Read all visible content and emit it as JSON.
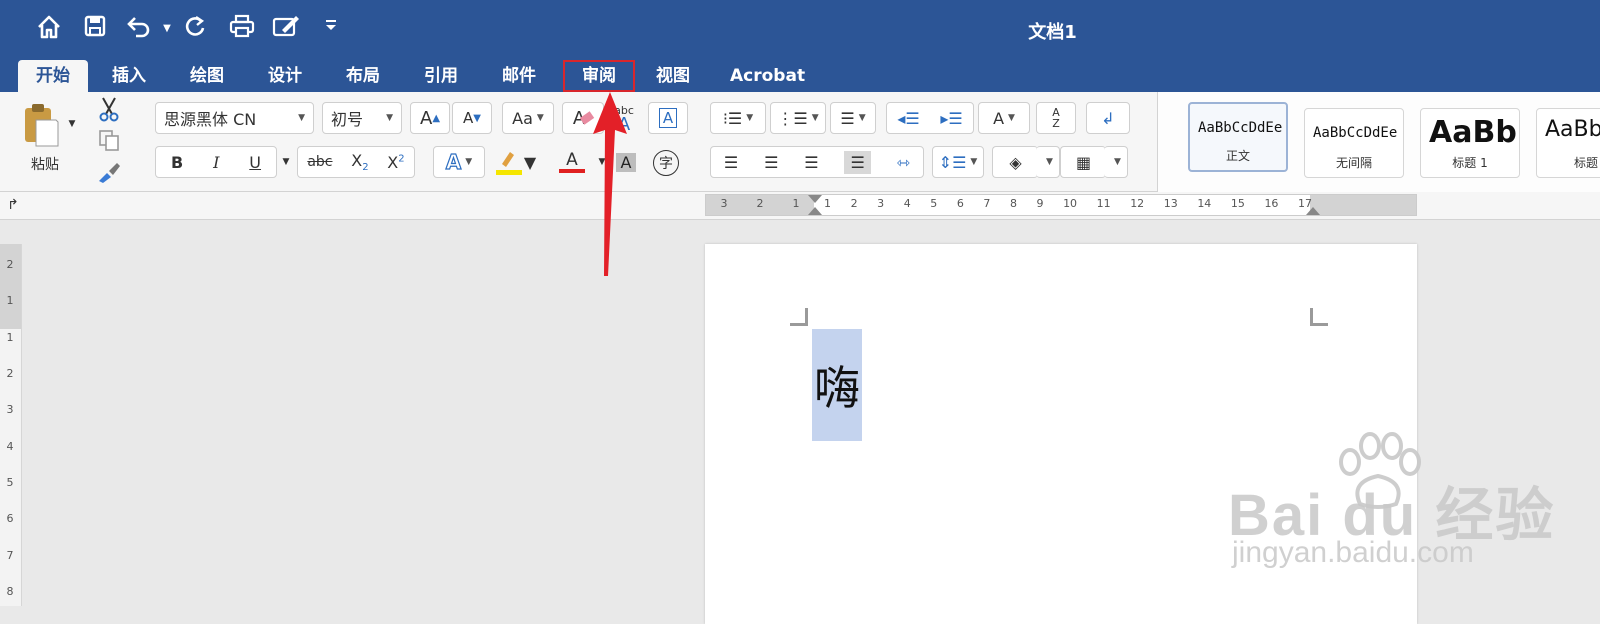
{
  "window": {
    "title": "文档1"
  },
  "quick_access": {
    "icons": [
      "home-icon",
      "save-icon",
      "undo-icon",
      "redo-icon",
      "print-icon",
      "edit-icon",
      "customize-icon"
    ]
  },
  "tabs": [
    {
      "label": "开始",
      "active": true
    },
    {
      "label": "插入"
    },
    {
      "label": "绘图"
    },
    {
      "label": "设计"
    },
    {
      "label": "布局"
    },
    {
      "label": "引用"
    },
    {
      "label": "邮件"
    },
    {
      "label": "审阅",
      "highlighted": true
    },
    {
      "label": "视图"
    },
    {
      "label": "Acrobat"
    }
  ],
  "ribbon": {
    "paste_label": "粘贴",
    "font_name": "思源黑体 CN",
    "font_size": "初号",
    "grow_font": "A",
    "shrink_font": "A",
    "change_case": "Aa",
    "clear_format": "A",
    "phonetic_top": "abc",
    "phonetic_bottom": "A",
    "char_border": "A",
    "bold": "B",
    "italic": "I",
    "underline": "U",
    "strike": "abc",
    "subscript": "X",
    "subscript_sub": "2",
    "superscript": "X",
    "superscript_sup": "2",
    "text_effect": "A",
    "font_color": "A",
    "char_shading": "A",
    "enclose": "字",
    "sort": "A",
    "sort_sub": "Z",
    "text_direction": "A",
    "styles": [
      {
        "sample": "AaBbCcDdEe",
        "name": "正文",
        "active": true
      },
      {
        "sample": "AaBbCcDdEe",
        "name": "无间隔"
      },
      {
        "sample": "AaBb(",
        "name": "标题 1"
      },
      {
        "sample": "AaBb",
        "name": "标题"
      }
    ]
  },
  "ruler": {
    "left_numbers": [
      "3",
      "2",
      "1"
    ],
    "right_numbers": [
      "1",
      "2",
      "3",
      "4",
      "5",
      "6",
      "7",
      "8",
      "9",
      "10",
      "11",
      "12",
      "13",
      "14",
      "15",
      "16",
      "17"
    ]
  },
  "vertical_ruler": {
    "numbers": [
      "2",
      "1",
      "1",
      "2",
      "3",
      "4",
      "5",
      "6",
      "7",
      "8"
    ]
  },
  "document": {
    "content": "嗨"
  },
  "watermark": {
    "logo": "Bai  du 经验",
    "url": "jingyan.baidu.com"
  },
  "colors": {
    "ribbon_blue": "#2c5596",
    "highlight_red": "#d8262c",
    "selection": "#c4d3ee",
    "highlighter_yellow": "#f5e600",
    "font_color_red": "#e02020"
  }
}
